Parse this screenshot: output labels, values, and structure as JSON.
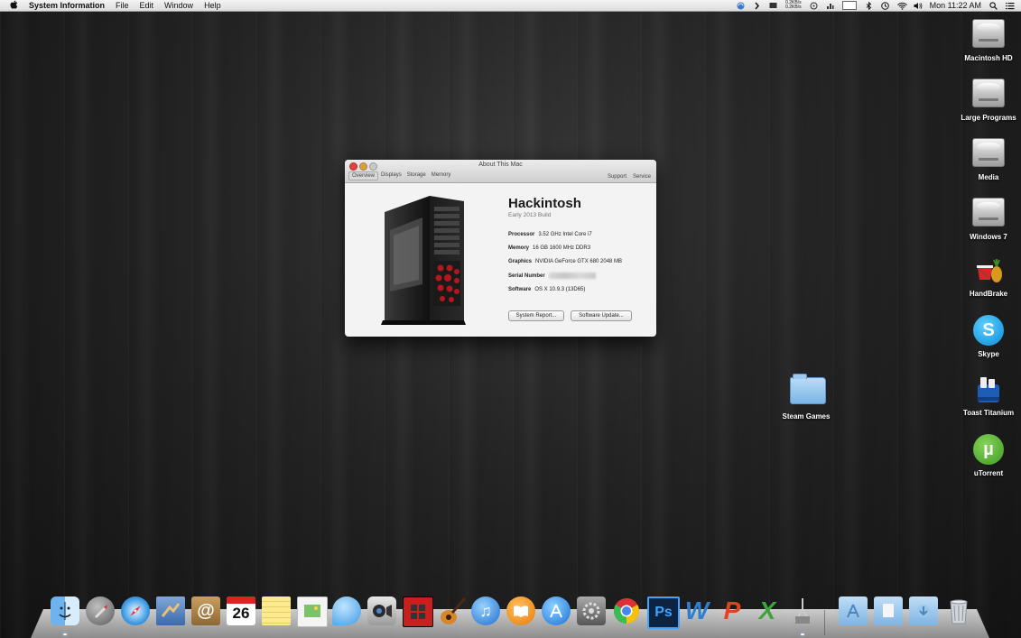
{
  "menubar": {
    "apple": "",
    "app_name": "System Information",
    "menus": [
      "File",
      "Edit",
      "Window",
      "Help"
    ],
    "net_up": "0.2KB/s",
    "net_down": "0.2KB/s",
    "clock": "Mon 11:22 AM"
  },
  "desktop_icons": [
    {
      "label": "Macintosh HD",
      "icon": "hard-drive-icon"
    },
    {
      "label": "Large Programs",
      "icon": "hard-drive-icon"
    },
    {
      "label": "Media",
      "icon": "hard-drive-icon"
    },
    {
      "label": "Windows 7",
      "icon": "hard-drive-icon"
    },
    {
      "label": "HandBrake",
      "icon": "handbrake-icon"
    },
    {
      "label": "Skype",
      "icon": "skype-icon"
    },
    {
      "label": "Toast Titanium",
      "icon": "toast-icon"
    },
    {
      "label": "uTorrent",
      "icon": "utorrent-icon"
    },
    {
      "label": "Steam Games",
      "icon": "folder-icon"
    }
  ],
  "about_window": {
    "title": "About This Mac",
    "tabs": [
      "Overview",
      "Displays",
      "Storage",
      "Memory"
    ],
    "right_links": [
      "Support",
      "Service"
    ],
    "hostname": "Hackintosh",
    "subtitle": "Early 2013 Build",
    "specs": [
      {
        "label": "Processor",
        "value": "3.52 GHz Intel Core i7"
      },
      {
        "label": "Memory",
        "value": "16 GB 1600 MHz DDR3"
      },
      {
        "label": "Graphics",
        "value": "NVIDIA GeForce GTX 680 2048 MB"
      },
      {
        "label": "Serial Number",
        "value": ""
      },
      {
        "label": "Software",
        "value": "OS X 10.9.3 (13D65)"
      }
    ],
    "buttons": [
      "System Report...",
      "Software Update..."
    ]
  },
  "dock": {
    "calendar_day": "26",
    "items": [
      "finder-icon",
      "launchpad-icon",
      "safari-icon",
      "mail-icon",
      "contacts-icon",
      "calendar-icon",
      "notes-icon",
      "preview-icon",
      "messages-icon",
      "facetime-icon",
      "photo-booth-icon",
      "garageband-icon",
      "itunes-icon",
      "ibooks-icon",
      "app-store-icon",
      "system-preferences-icon",
      "chrome-icon",
      "photoshop-icon",
      "word-icon",
      "powerpoint-icon",
      "excel-icon",
      "utilities-icon",
      "applications-folder-icon",
      "documents-folder-icon",
      "downloads-folder-icon",
      "trash-icon"
    ],
    "ps_label": "Ps",
    "w_label": "W",
    "p_label": "P",
    "x_label": "X"
  },
  "colors": {
    "close": "#e0443e",
    "minimize": "#dea123",
    "zoom": "#b3b3b3"
  }
}
